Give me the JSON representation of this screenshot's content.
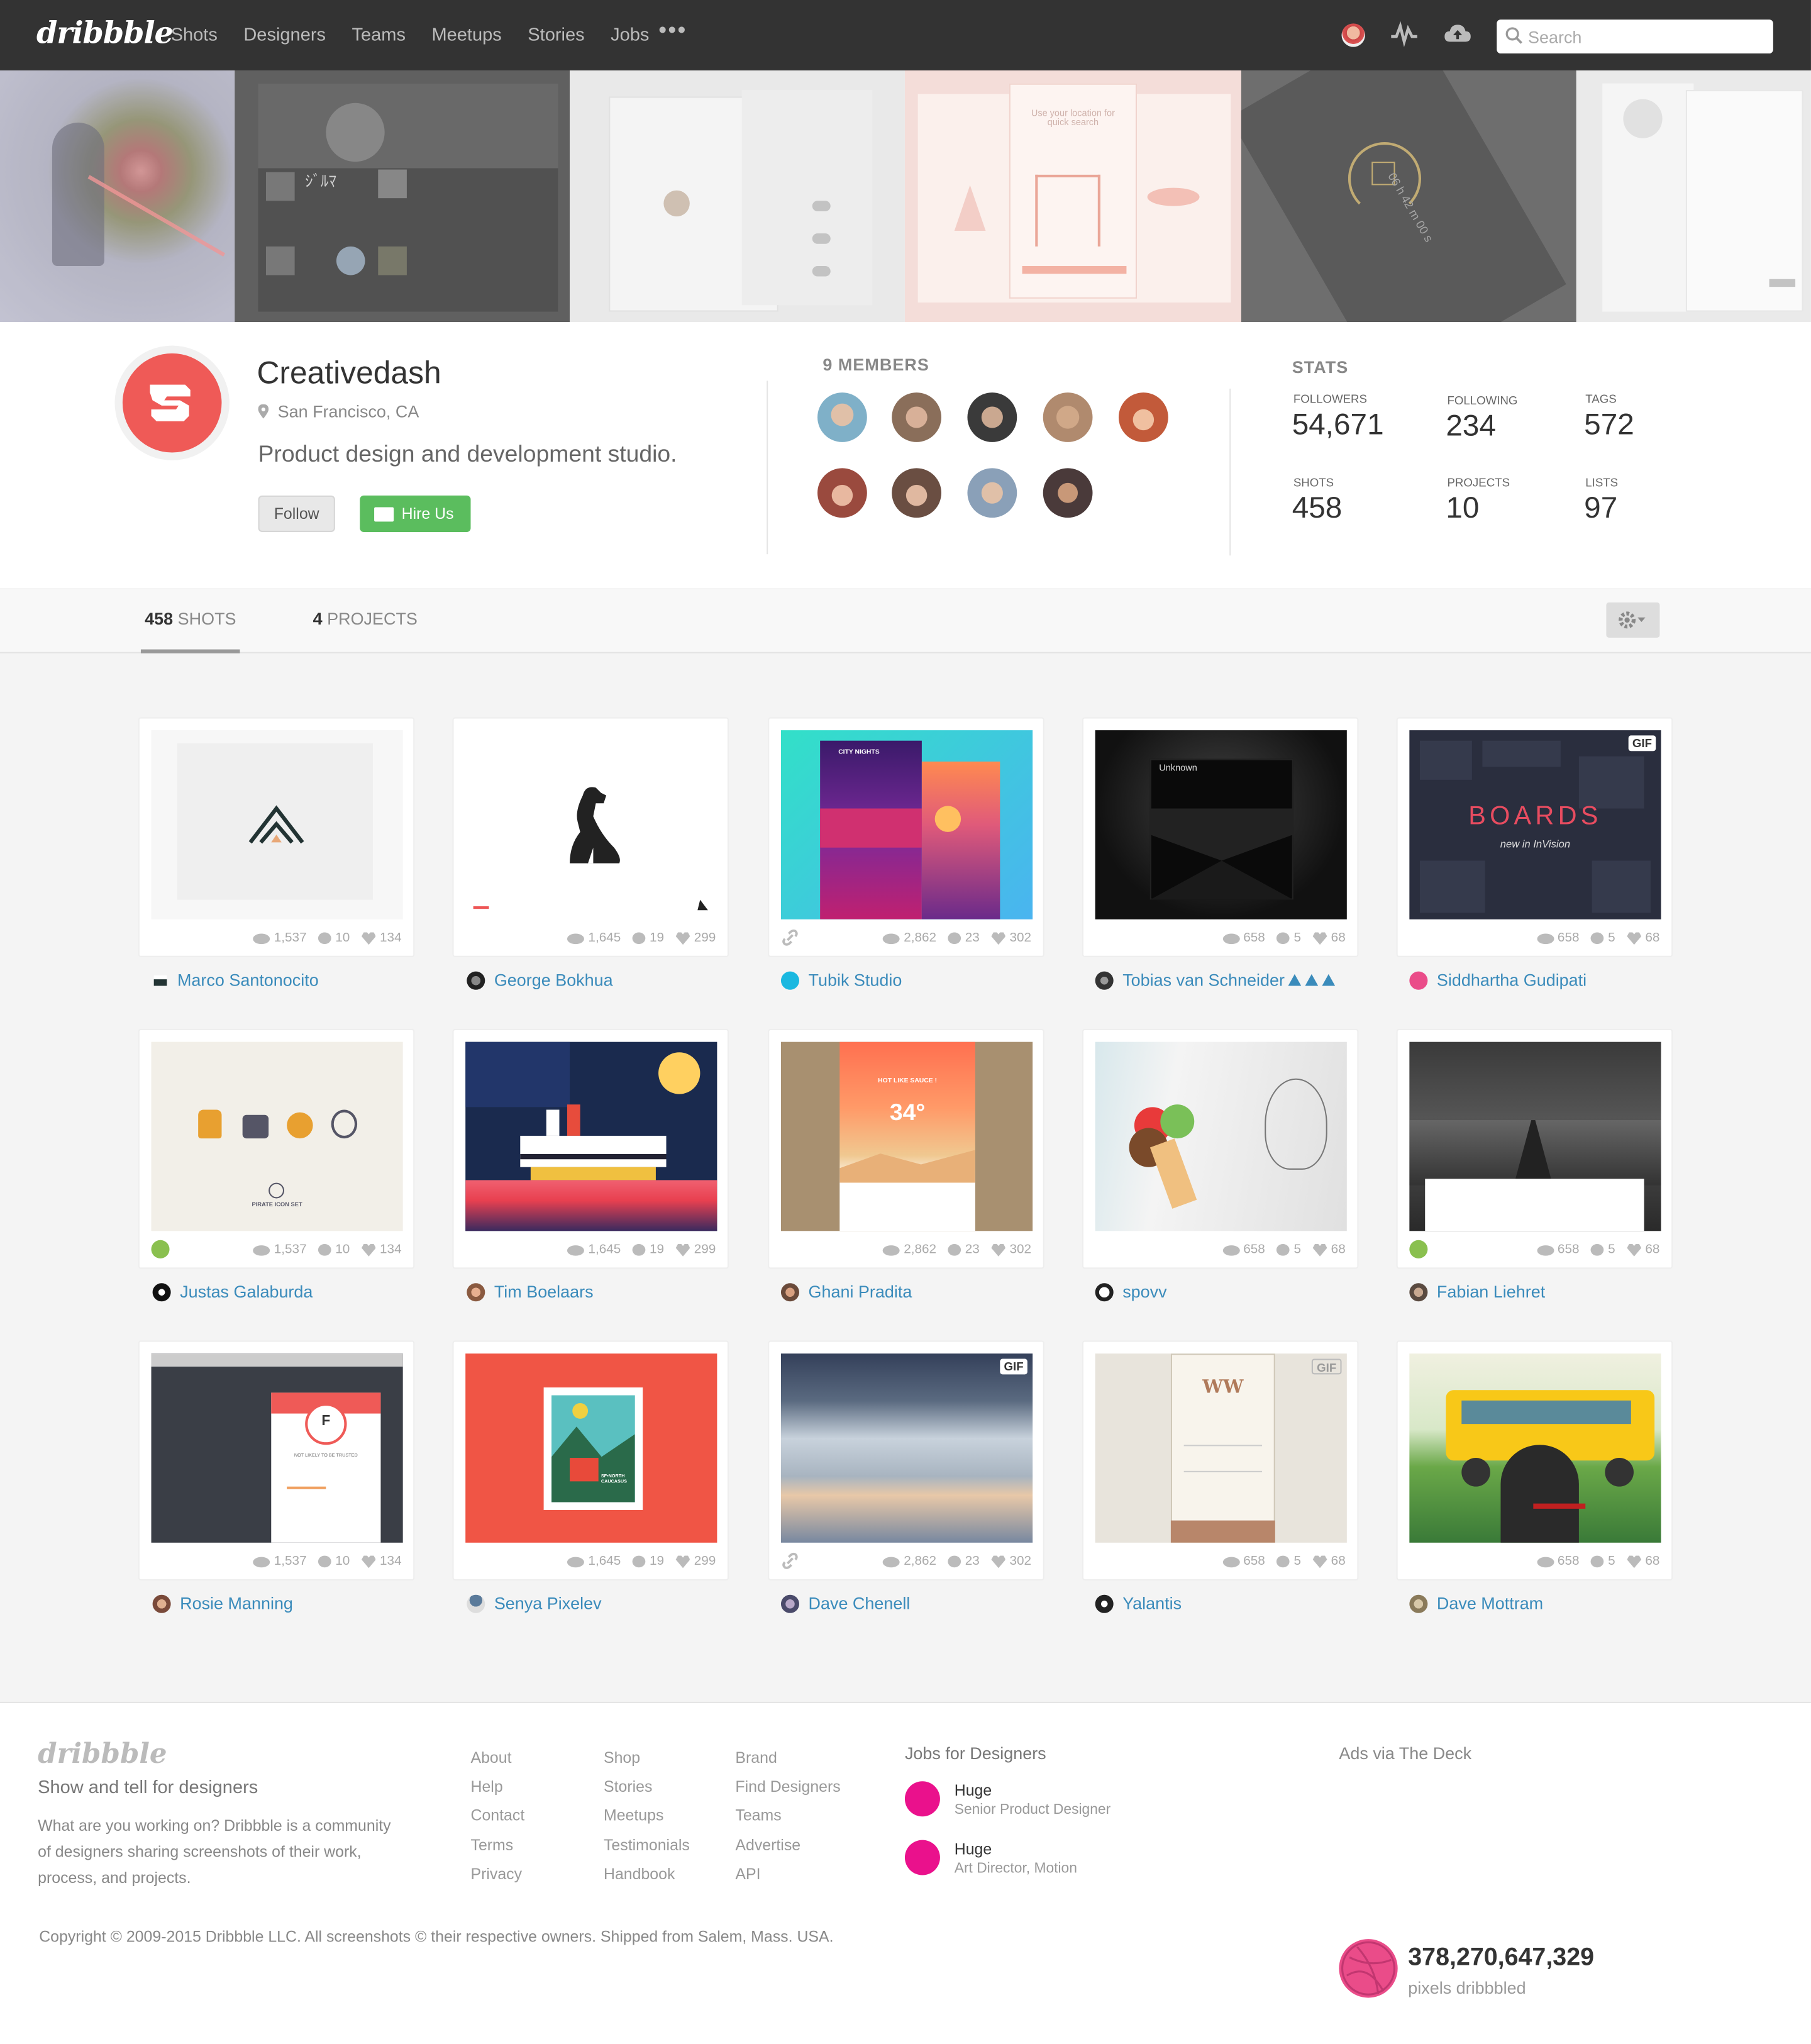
{
  "nav": {
    "logo": "dribbble",
    "links": [
      "Shots",
      "Designers",
      "Teams",
      "Meetups",
      "Stories",
      "Jobs"
    ],
    "more": "•••",
    "search_placeholder": "Search"
  },
  "banner": {
    "panels": [
      {
        "text": ""
      },
      {
        "text": "ｼﾞﾙﾏ"
      },
      {
        "text": ""
      },
      {
        "text": "Use your location for quick search"
      },
      {
        "text": "06 h 42 m 00 s"
      },
      {
        "text": ""
      }
    ]
  },
  "profile": {
    "name": "Creativedash",
    "location": "San Francisco, CA",
    "bio": "Product design and development studio.",
    "follow_label": "Follow",
    "hire_label": "Hire Us",
    "members_title": "9 MEMBERS",
    "members": [
      {
        "color": "#7fb0c8"
      },
      {
        "color": "#8a6e5a"
      },
      {
        "color": "#3a3a3a"
      },
      {
        "color": "#b08a6e"
      },
      {
        "color": "#c25a3a"
      },
      {
        "color": "#9a4a3e"
      },
      {
        "color": "#6a4e42"
      },
      {
        "color": "#8aa0b8"
      },
      {
        "color": "#4a3a3a"
      }
    ],
    "stats_title": "STATS",
    "stats": [
      {
        "label": "FOLLOWERS",
        "value": "54,671"
      },
      {
        "label": "FOLLOWING",
        "value": "234"
      },
      {
        "label": "TAGS",
        "value": "572"
      },
      {
        "label": "SHOTS",
        "value": "458"
      },
      {
        "label": "PROJECTS",
        "value": "10"
      },
      {
        "label": "LISTS",
        "value": "97"
      }
    ]
  },
  "tabs": {
    "shots_count": "458",
    "shots_label": "SHOTS",
    "projects_count": "4",
    "projects_label": "PROJECTS"
  },
  "shots": [
    {
      "views": "1,537",
      "comments": "10",
      "likes": "134",
      "author": "Marco Santonocito",
      "thumb": "Mountain logo",
      "extra": ""
    },
    {
      "views": "1,645",
      "comments": "19",
      "likes": "299",
      "author": "George Bokhua",
      "thumb": "Dog logo",
      "extra": ""
    },
    {
      "views": "2,862",
      "comments": "23",
      "likes": "302",
      "author": "Tubik Studio",
      "thumb": "City Nights app",
      "extra": "attach"
    },
    {
      "views": "658",
      "comments": "5",
      "likes": "68",
      "author": "Tobias van Schneider",
      "thumb": "Unknown",
      "extra": "triangles"
    },
    {
      "views": "658",
      "comments": "5",
      "likes": "68",
      "author": "Siddhartha Gudipati",
      "thumb": "BOARDS",
      "extra": "gif"
    },
    {
      "views": "1,537",
      "comments": "10",
      "likes": "134",
      "author": "Justas Galaburda",
      "thumb": "Pirate Icon Set",
      "extra": "rebound"
    },
    {
      "views": "1,645",
      "comments": "19",
      "likes": "299",
      "author": "Tim Boelaars",
      "thumb": "Cruise ship",
      "extra": ""
    },
    {
      "views": "2,862",
      "comments": "23",
      "likes": "302",
      "author": "Ghani Pradita",
      "thumb": "Hot like sauce 34",
      "extra": ""
    },
    {
      "views": "658",
      "comments": "5",
      "likes": "68",
      "author": "spovv",
      "thumb": "Ice cream",
      "extra": ""
    },
    {
      "views": "658",
      "comments": "5",
      "likes": "68",
      "author": "Fabian Liehret",
      "thumb": "Road",
      "extra": "rebound"
    },
    {
      "views": "1,537",
      "comments": "10",
      "likes": "134",
      "author": "Rosie Manning",
      "thumb": "Not likely to be trusted",
      "extra": ""
    },
    {
      "views": "1,645",
      "comments": "19",
      "likes": "299",
      "author": "Senya Pixelev",
      "thumb": "North Caucasus stamp",
      "extra": ""
    },
    {
      "views": "2,862",
      "comments": "23",
      "likes": "302",
      "author": "Dave Chenell",
      "thumb": "Clouds",
      "extra": "attach-gif"
    },
    {
      "views": "658",
      "comments": "5",
      "likes": "68",
      "author": "Yalantis",
      "thumb": "WW login",
      "extra": "gif-outline"
    },
    {
      "views": "658",
      "comments": "5",
      "likes": "68",
      "author": "Dave Mottram",
      "thumb": "School bus",
      "extra": ""
    }
  ],
  "thumb_text": {
    "unknown": "Unknown",
    "boards": "BOARDS",
    "boards_sub": "new in InVision",
    "pirate": "PIRATE ICON SET",
    "hot": "HOT LIKE SAUCE !",
    "temp": "34°",
    "city": "CITY NIGHTS",
    "trust_letter": "F",
    "trust": "NOT LIKELY TO BE TRUSTED",
    "caucasus": "SF•NORTH CAUCASUS",
    "ww": "WW",
    "gif": "GIF"
  },
  "footer": {
    "logo": "dribbble",
    "tagline": "Show and tell for designers",
    "description": "What are you working on? Dribbble is a community of designers sharing screenshots of their work, process, and projects.",
    "col1": [
      "About",
      "Help",
      "Contact",
      "Terms",
      "Privacy"
    ],
    "col2": [
      "Shop",
      "Stories",
      "Meetups",
      "Testimonials",
      "Handbook"
    ],
    "col3": [
      "Brand",
      "Find Designers",
      "Teams",
      "Advertise",
      "API"
    ],
    "jobs_title": "Jobs for Designers",
    "jobs": [
      {
        "company": "Huge",
        "title": "Senior Product Designer"
      },
      {
        "company": "Huge",
        "title": "Art Director, Motion"
      }
    ],
    "ads": "Ads via The Deck",
    "copyright": "Copyright © 2009-2015 Dribbble LLC. All screenshots © their respective owners. Shipped from Salem, Mass. USA.",
    "pixel_count": "378,270,647,329",
    "pixel_label": "pixels dribbbled"
  },
  "colors": {
    "brand_pink": "#ea4c89",
    "link_blue": "#3a8bbb",
    "hire_green": "#5bbd5e",
    "logo_red": "#ef5a57"
  }
}
